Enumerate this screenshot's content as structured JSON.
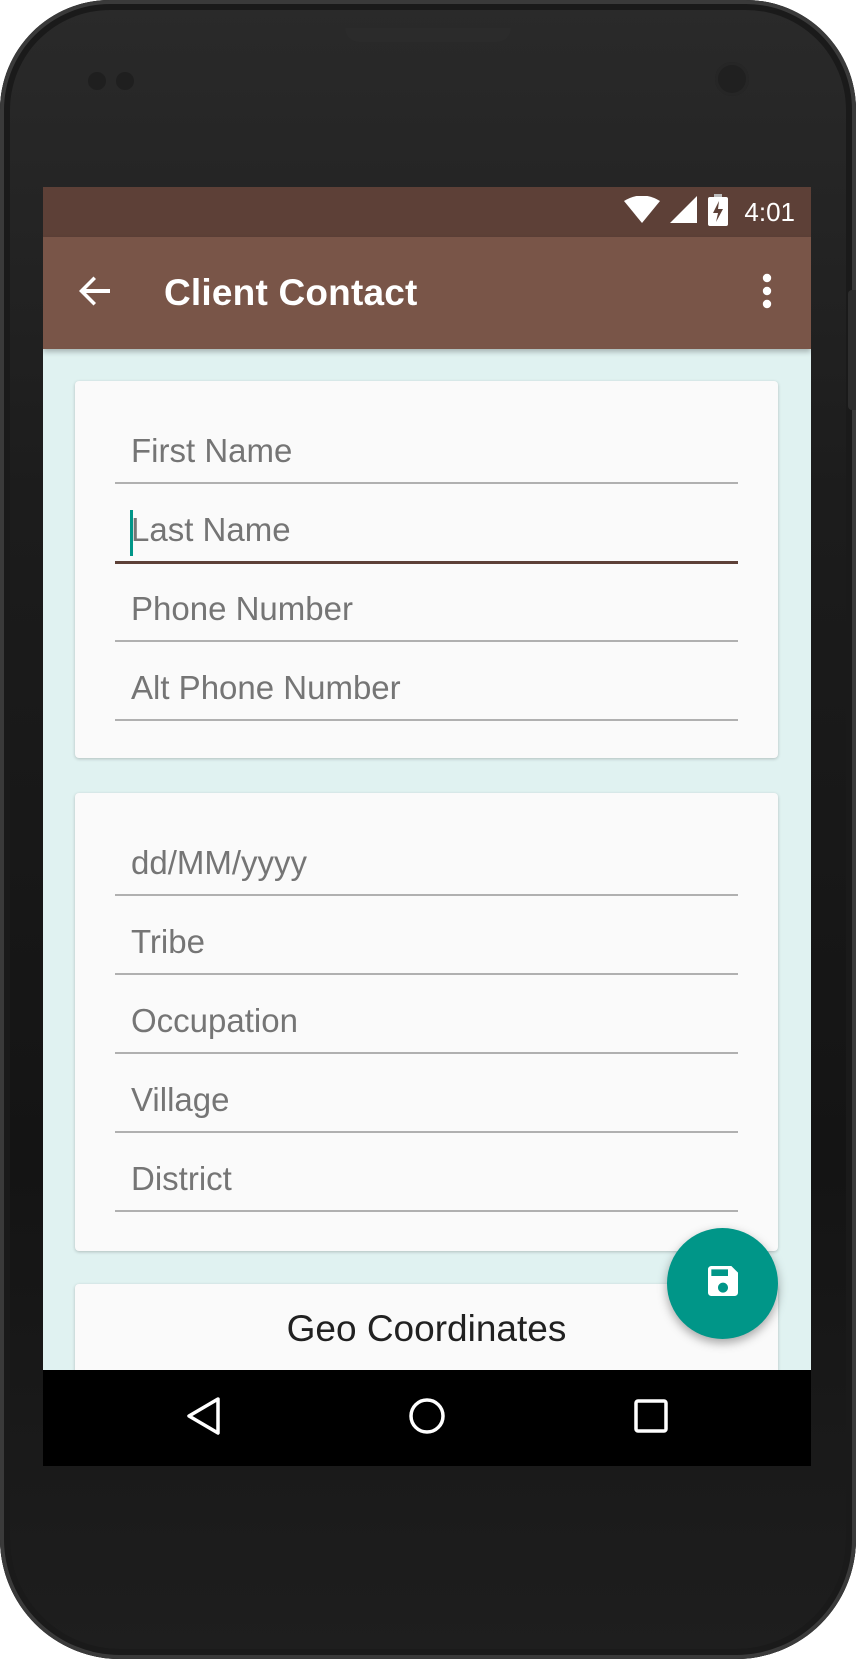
{
  "status_bar": {
    "time": "4:01",
    "icons": [
      "wifi-icon",
      "signal-icon",
      "battery-charging-icon"
    ]
  },
  "app_bar": {
    "title": "Client Contact",
    "back_icon": "arrow-back-icon",
    "menu_icon": "more-vert-icon"
  },
  "contact_card": {
    "fields": [
      {
        "placeholder": "First Name",
        "value": ""
      },
      {
        "placeholder": "Last Name",
        "value": "",
        "focused": true
      },
      {
        "placeholder": "Phone Number",
        "value": ""
      },
      {
        "placeholder": "Alt Phone Number",
        "value": ""
      }
    ]
  },
  "details_card": {
    "fields": [
      {
        "placeholder": "dd/MM/yyyy",
        "value": ""
      },
      {
        "placeholder": "Tribe",
        "value": ""
      },
      {
        "placeholder": "Occupation",
        "value": ""
      },
      {
        "placeholder": "Village",
        "value": ""
      },
      {
        "placeholder": "District",
        "value": ""
      }
    ]
  },
  "geo_card": {
    "label": "Geo Coordinates"
  },
  "fab": {
    "icon": "save-icon"
  },
  "nav_bar": {
    "icons": [
      "nav-back-icon",
      "nav-home-icon",
      "nav-recents-icon"
    ]
  },
  "colors": {
    "primary_dark": "#5d4037",
    "primary": "#795548",
    "accent": "#009688",
    "background": "#e0f2f1",
    "card": "#fafafa"
  }
}
